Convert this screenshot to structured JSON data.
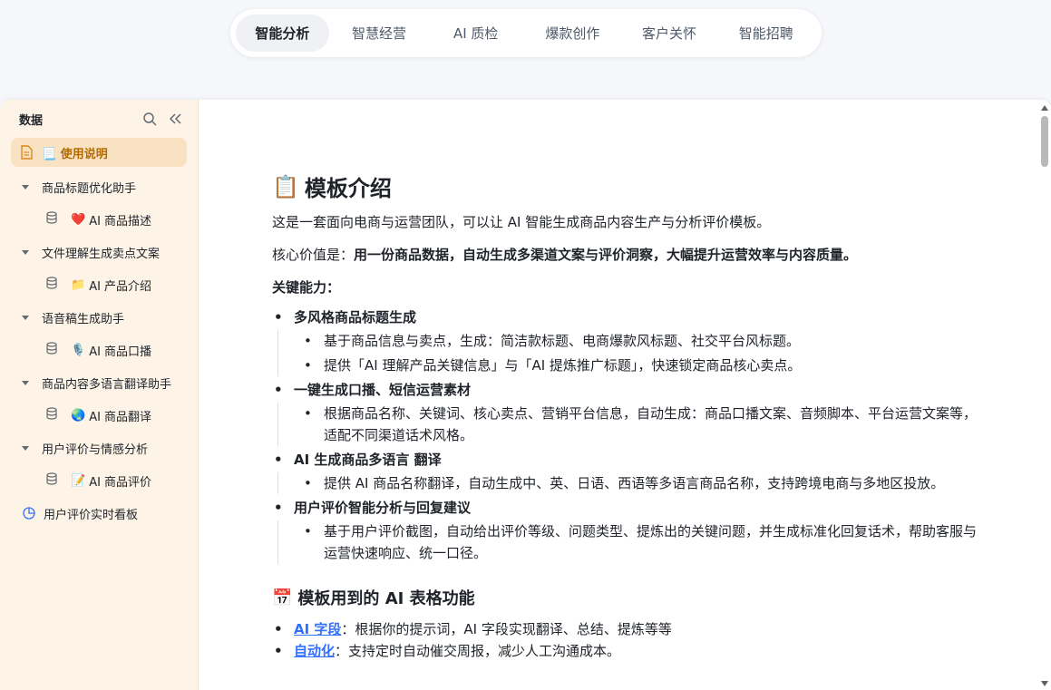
{
  "tabs": [
    {
      "label": "智能分析",
      "active": true
    },
    {
      "label": "智慧经营",
      "active": false
    },
    {
      "label": "AI 质检",
      "active": false
    },
    {
      "label": "爆款创作",
      "active": false
    },
    {
      "label": "客户关怀",
      "active": false
    },
    {
      "label": "智能招聘",
      "active": false
    }
  ],
  "sidebar": {
    "title": "数据",
    "usage_label": "📃 使用说明",
    "groups": [
      {
        "label": "商品标题优化助手",
        "child": "AI 商品描述",
        "child_emoji": "❤️"
      },
      {
        "label": "文件理解生成卖点文案",
        "child": "AI 产品介绍",
        "child_emoji": "📁"
      },
      {
        "label": "语音稿生成助手",
        "child": "AI 商品口播",
        "child_emoji": "🎙️"
      },
      {
        "label": "商品内容多语言翻译助手",
        "child": "AI 商品翻译",
        "child_emoji": "🌏"
      },
      {
        "label": "用户评价与情感分析",
        "child": "AI 商品评价",
        "child_emoji": "📝"
      }
    ],
    "dashboard_label": "用户评价实时看板"
  },
  "doc": {
    "h1_emoji": "📋",
    "h1": "模板介绍",
    "intro": "这是一套面向电商与运营团队，可以让 AI 智能生成商品内容生产与分析评价模板。",
    "core_prefix": "核心价值是：",
    "core_bold": "用一份商品数据，自动生成多渠道文案与评价洞察，大幅提升运营效率与内容质量。",
    "capability_heading": "关键能力：",
    "features": [
      {
        "title": "多风格商品标题生成",
        "bullets": [
          "基于商品信息与卖点，生成：简洁款标题、电商爆款风标题、社交平台风标题。",
          "提供「AI 理解产品关键信息」与「AI 提炼推广标题」，快速锁定商品核心卖点。"
        ]
      },
      {
        "title": "一键生成口播、短信运营素材",
        "bullets": [
          "根据商品名称、关键词、核心卖点、营销平台信息，自动生成：商品口播文案、音频脚本、平台运营文案等，适配不同渠道话术风格。"
        ]
      },
      {
        "title": "AI 生成商品多语言 翻译",
        "bullets": [
          "提供 AI 商品名称翻译，自动生成中、英、日语、西语等多语言商品名称，支持跨境电商与多地区投放。"
        ]
      },
      {
        "title": "用户评价智能分析与回复建议",
        "bullets": [
          "基于用户评价截图，自动给出评价等级、问题类型、提炼出的关键问题，并生成标准化回复话术，帮助客服与运营快速响应、统一口径。"
        ]
      }
    ],
    "h2_emoji": "📅",
    "h2": "模板用到的 AI 表格功能",
    "functions": [
      {
        "link": "AI 字段",
        "text": "：根据你的提示词，AI 字段实现翻译、总结、提炼等等"
      },
      {
        "link": "自动化",
        "text": "：支持定时自动催交周报，减少人工沟通成本。"
      }
    ]
  }
}
